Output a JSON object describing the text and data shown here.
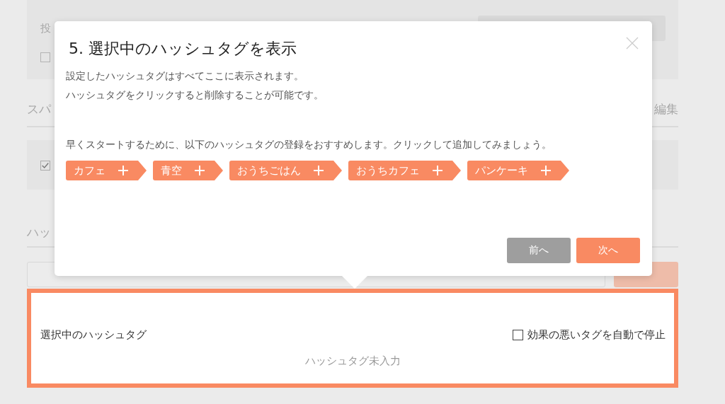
{
  "background": {
    "post_label": "投",
    "post_checkbox": {
      "checked": false
    },
    "spam_heading": "スパ",
    "spam_edit_link": "編集",
    "spam_checkbox": {
      "checked": true
    },
    "hashtag_heading": "ハッ"
  },
  "selected_panel": {
    "title": "選択中のハッシュタグ",
    "auto_stop": {
      "label": "効果の悪いタグを自動で停止",
      "checked": false
    },
    "empty_text": "ハッシュタグ未入力"
  },
  "dialog": {
    "title": "5. 選択中のハッシュタグを表示",
    "description": [
      "設定したハッシュタグはすべてここに表示されます。",
      "ハッシュタグをクリックすると削除することが可能です。"
    ],
    "recommend_text": "早くスタートするために、以下のハッシュタグの登録をおすすめします。クリックして追加してみましょう。",
    "tags": [
      "カフェ",
      "青空",
      "おうちごはん",
      "おうちカフェ",
      "パンケーキ"
    ],
    "buttons": [
      {
        "label": "前へ",
        "kind": "secondary"
      },
      {
        "label": "次へ",
        "kind": "primary"
      }
    ]
  }
}
